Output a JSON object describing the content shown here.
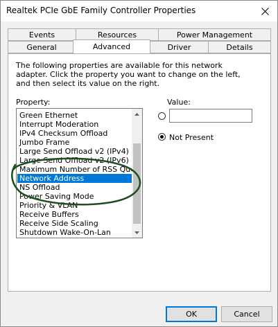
{
  "window": {
    "title": "Realtek PCIe GbE Family Controller Properties"
  },
  "tabs_row1": [
    "Events",
    "Resources",
    "Power Management"
  ],
  "tabs_row2": [
    "General",
    "Advanced",
    "Driver",
    "Details"
  ],
  "selected_tab": "Advanced",
  "description": "The following properties are available for this network adapter. Click the property you want to change on the left, and then select its value on the right.",
  "property_label": "Property:",
  "value_label": "Value:",
  "properties": [
    "Green Ethernet",
    "Interrupt Moderation",
    "IPv4 Checksum Offload",
    "Jumbo Frame",
    "Large Send Offload v2 (IPv4)",
    "Large Send Offload v2 (IPv6)",
    "Maximum Number of RSS Queues",
    "Network Address",
    "NS Offload",
    "Power Saving Mode",
    "Priority & VLAN",
    "Receive Buffers",
    "Receive Side Scaling",
    "Shutdown Wake-On-Lan"
  ],
  "selected_property": "Network Address",
  "value_input": "",
  "not_present_label": "Not Present",
  "buttons": {
    "ok": "OK",
    "cancel": "Cancel"
  },
  "colors": {
    "selection": "#0078d7",
    "annotation": "#1e4d1e"
  }
}
